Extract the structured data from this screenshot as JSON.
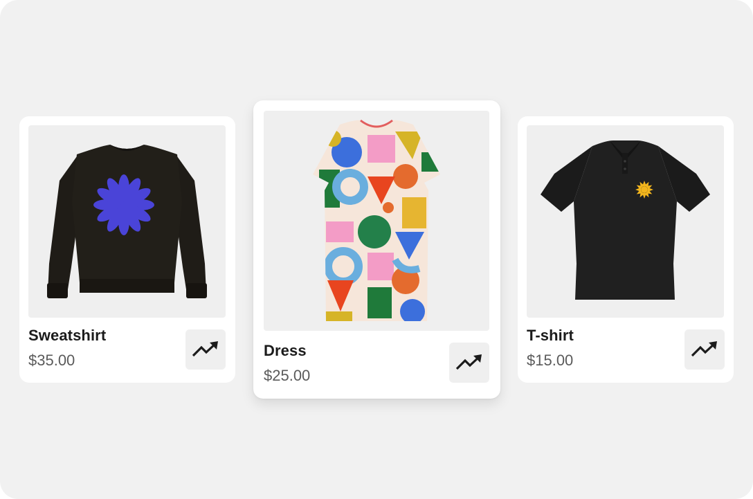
{
  "products": [
    {
      "name": "Sweatshirt",
      "price": "$35.00",
      "action_icon": "trending-up-icon"
    },
    {
      "name": "Dress",
      "price": "$25.00",
      "action_icon": "trending-up-icon"
    },
    {
      "name": "T-shirt",
      "price": "$15.00",
      "action_icon": "trending-up-icon"
    }
  ],
  "colors": {
    "background": "#f1f1f1",
    "card": "#ffffff",
    "photo_background": "#efefef",
    "title_text": "#1b1b1b",
    "price_text": "#5a5a5a",
    "icon": "#1b1b1b"
  }
}
